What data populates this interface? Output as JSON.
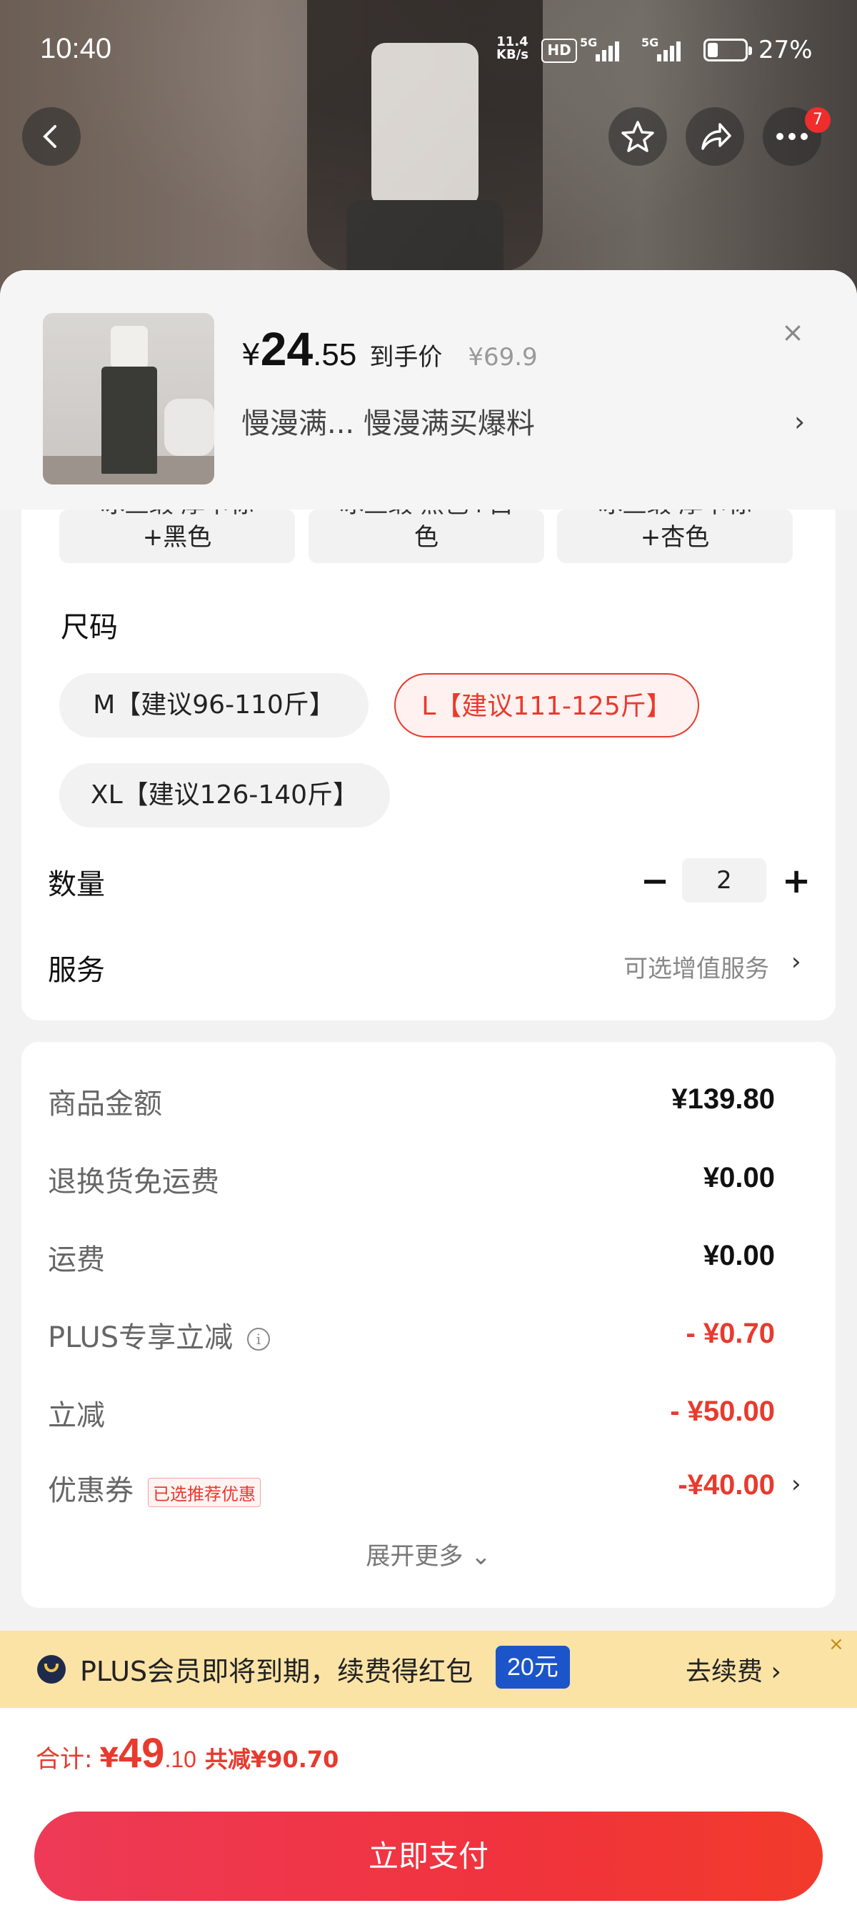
{
  "status": {
    "time": "10:40",
    "net_speed_top": "11.4",
    "net_speed_unit": "KB/s",
    "hd": "HD",
    "sim1": "5G",
    "sim2": "5G",
    "battery_pct": "27%",
    "battery_level": 0.27
  },
  "nav": {
    "back_icon": "chevron-left-icon",
    "fav_icon": "star-icon",
    "share_icon": "share-icon",
    "more_icon": "more-icon",
    "badge_count": "7"
  },
  "product": {
    "yen": "¥",
    "price_int": "24",
    "price_dec": ".55",
    "price_tag": "到手价",
    "orig_price": "¥69.9",
    "promo": "慢漫满...  慢漫满买爆料",
    "promo_chevron": "›",
    "close": "×"
  },
  "variants": [
    {
      "line1": "冰丝缎 厚卡标",
      "line2": "+黑色"
    },
    {
      "line1": "冰丝缎 黑色+白",
      "line2": "色"
    },
    {
      "line1": "冰丝缎 厚卡标",
      "line2": "+杏色"
    }
  ],
  "size": {
    "title": "尺码",
    "options": [
      {
        "label": "M【建议96-110斤】",
        "selected": false
      },
      {
        "label": "L【建议111-125斤】",
        "selected": true
      },
      {
        "label": "XL【建议126-140斤】",
        "selected": false
      }
    ]
  },
  "quantity": {
    "label": "数量",
    "minus": "−",
    "value": "2",
    "plus": "+"
  },
  "service": {
    "label": "服务",
    "hint": "可选增值服务",
    "chevron": "›"
  },
  "fees": [
    {
      "label": "商品金额",
      "value": "¥139.80",
      "red": false
    },
    {
      "label": "退换货免运费",
      "value": "¥0.00",
      "red": false
    },
    {
      "label": "运费",
      "value": "¥0.00",
      "red": false
    },
    {
      "label": "PLUS专享立减",
      "value": "- ¥0.70",
      "red": true,
      "info": "i"
    },
    {
      "label": "立减",
      "value": "- ¥50.00",
      "red": true
    },
    {
      "label": "优惠券",
      "value": "-¥40.00",
      "red": true,
      "tag": "已选推荐优惠",
      "chevron": "›"
    }
  ],
  "expand": "展开更多 ⌄",
  "plus_bar": {
    "text": "PLUS会员即将到期，续费得红包",
    "amount": "20元",
    "action": "去续费 ›",
    "close": "×"
  },
  "footer": {
    "total_label": "合计:",
    "yen": "¥",
    "total_int": "49",
    "total_dec": ".10",
    "saved": "共减¥90.70",
    "pay": "立即支付"
  },
  "colors": {
    "accent": "#e83a2e",
    "plus_bg": "#fbe3a6",
    "plus_badge": "#1b55c9",
    "pay_button": "#f0333d"
  }
}
